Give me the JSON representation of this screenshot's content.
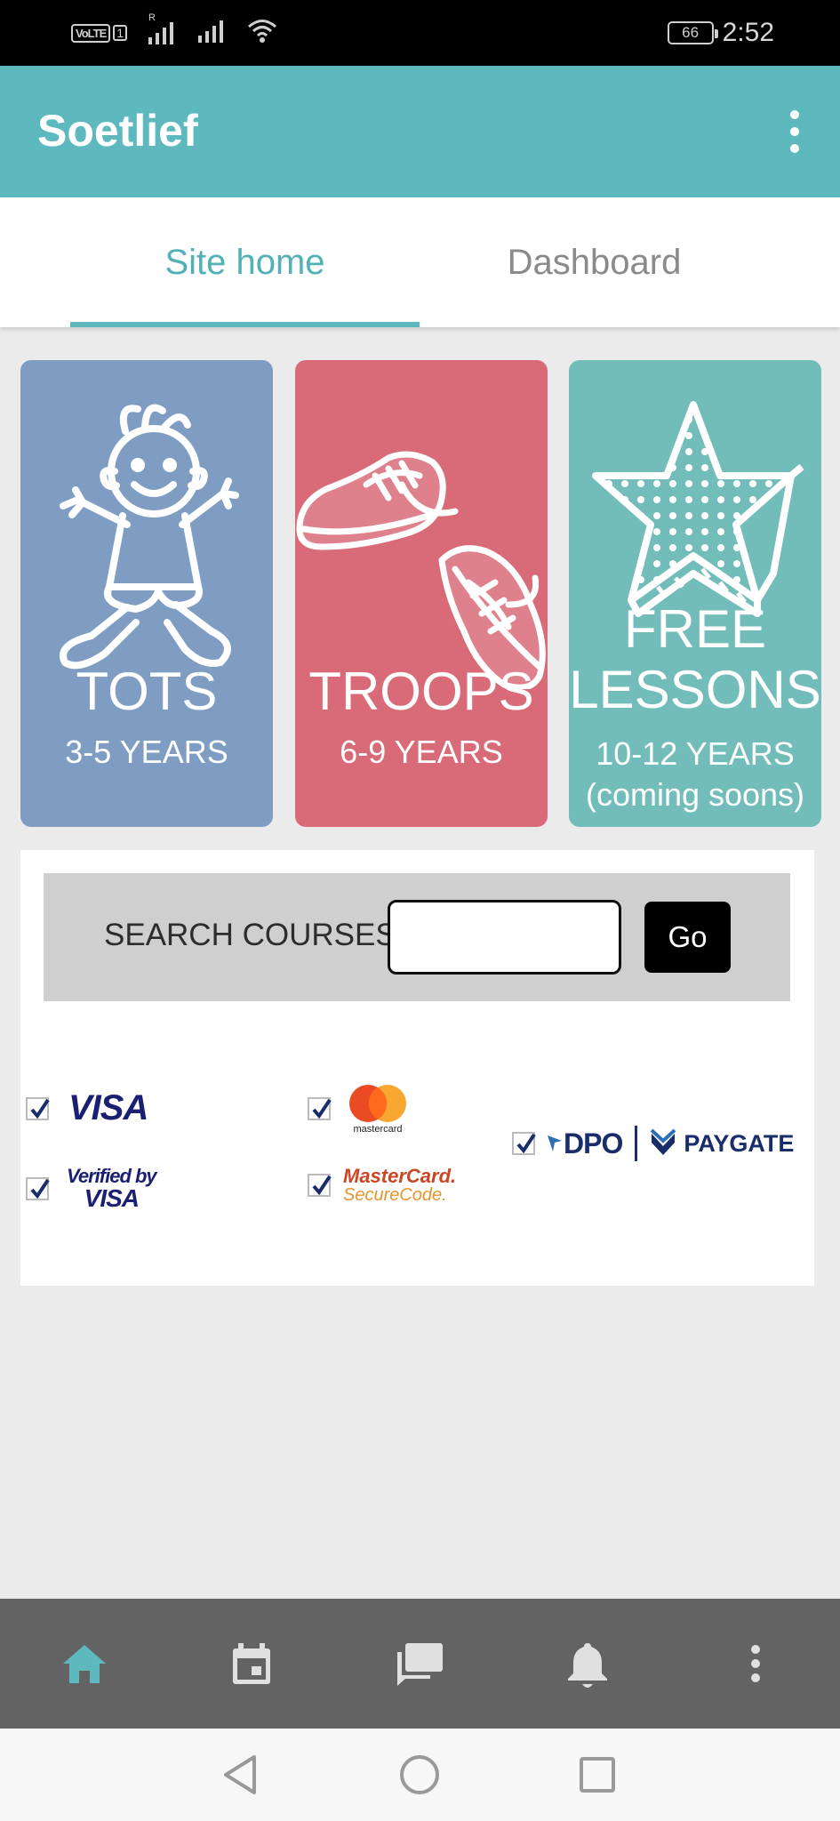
{
  "status_bar": {
    "carrier_badge": "VoLTE",
    "sim_number": "1",
    "roaming_mark": "R",
    "battery_level": "66",
    "time": "2:52",
    "icons": [
      "volte-icon",
      "signal-icon",
      "signal-icon",
      "wifi-icon",
      "battery-icon"
    ]
  },
  "app_bar": {
    "title": "Soetlief",
    "menu_icon": "more-vert-icon",
    "color": "#5db9bd"
  },
  "tabs": [
    {
      "label": "Site home",
      "active": true
    },
    {
      "label": "Dashboard",
      "active": false
    }
  ],
  "cards": [
    {
      "title": "TOTS",
      "subtitle": "3-5 YEARS",
      "icon": "child-icon",
      "color": "#7f9dc3"
    },
    {
      "title": "TROOPS",
      "subtitle": "6-9 YEARS",
      "icon": "sneakers-icon",
      "color": "#d96b78"
    },
    {
      "title_line1": "FREE",
      "title_line2": "LESSONS",
      "subtitle_line1": "10-12 YEARS",
      "subtitle_line2": "(coming soons)",
      "icon": "star-icon",
      "color": "#72bdb9"
    }
  ],
  "search": {
    "label": "SEARCH COURSES:",
    "value": "",
    "button_label": "Go"
  },
  "payment_logos": {
    "visa": "VISA",
    "verified_by": "Verified by",
    "verified_visa": "VISA",
    "mastercard": "mastercard",
    "securecode_line1": "MasterCard.",
    "securecode_line2": "SecureCode.",
    "dpo": "DPO",
    "paygate": "PAYGATE"
  },
  "bottom_nav": [
    {
      "icon": "home-icon",
      "active": true
    },
    {
      "icon": "calendar-icon",
      "active": false
    },
    {
      "icon": "messages-icon",
      "active": false
    },
    {
      "icon": "bell-icon",
      "active": false
    },
    {
      "icon": "more-vert-icon",
      "active": false
    }
  ],
  "system_nav": [
    "back-icon",
    "home-circle-icon",
    "recents-icon"
  ]
}
